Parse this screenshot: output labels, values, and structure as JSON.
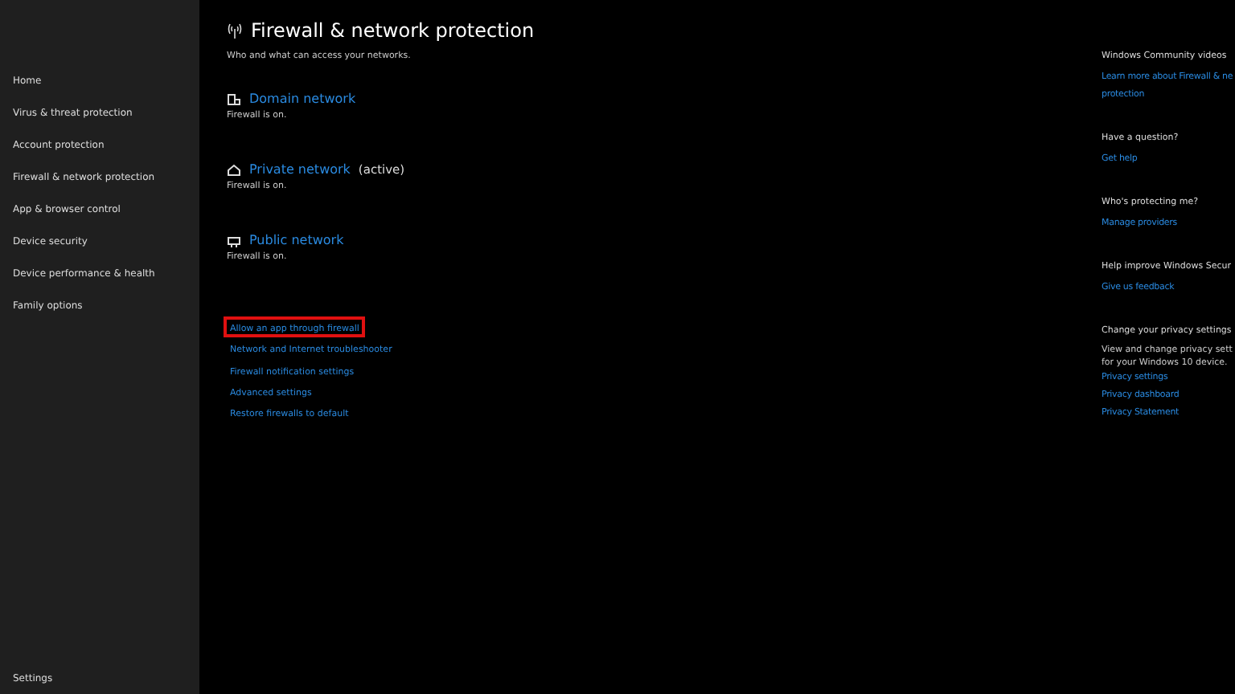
{
  "sidebar": {
    "items": [
      {
        "label": "Home"
      },
      {
        "label": "Virus & threat protection"
      },
      {
        "label": "Account protection"
      },
      {
        "label": "Firewall & network protection"
      },
      {
        "label": "App & browser control"
      },
      {
        "label": "Device security"
      },
      {
        "label": "Device performance & health"
      },
      {
        "label": "Family options"
      }
    ],
    "footer": "Settings"
  },
  "header": {
    "title": "Firewall & network protection",
    "subtitle": "Who and what can access your networks."
  },
  "networks": [
    {
      "kind": "domain",
      "name": "Domain network",
      "status": "Firewall is on."
    },
    {
      "kind": "private",
      "name": "Private network",
      "badge": "(active)",
      "status": "Firewall is on."
    },
    {
      "kind": "public",
      "name": "Public network",
      "status": "Firewall is on."
    }
  ],
  "links": [
    {
      "label": "Allow an app through firewall",
      "highlighted": true
    },
    {
      "label": "Network and Internet troubleshooter",
      "highlighted": false
    },
    {
      "label": "Firewall notification settings",
      "highlighted": false
    },
    {
      "label": "Advanced settings",
      "highlighted": false
    },
    {
      "label": "Restore firewalls to default",
      "highlighted": false
    }
  ],
  "aside": [
    {
      "heading": "Windows Community videos",
      "links": [
        "Learn more about Firewall & ne",
        "protection"
      ]
    },
    {
      "heading": "Have a question?",
      "links": [
        "Get help"
      ]
    },
    {
      "heading": "Who's protecting me?",
      "links": [
        "Manage providers"
      ]
    },
    {
      "heading": "Help improve Windows Secur",
      "links": [
        "Give us feedback"
      ]
    },
    {
      "heading": "Change your privacy settings",
      "text": [
        "View and change privacy sett",
        "for your Windows 10 device."
      ],
      "links": [
        "Privacy settings",
        "Privacy dashboard",
        "Privacy Statement"
      ]
    }
  ]
}
